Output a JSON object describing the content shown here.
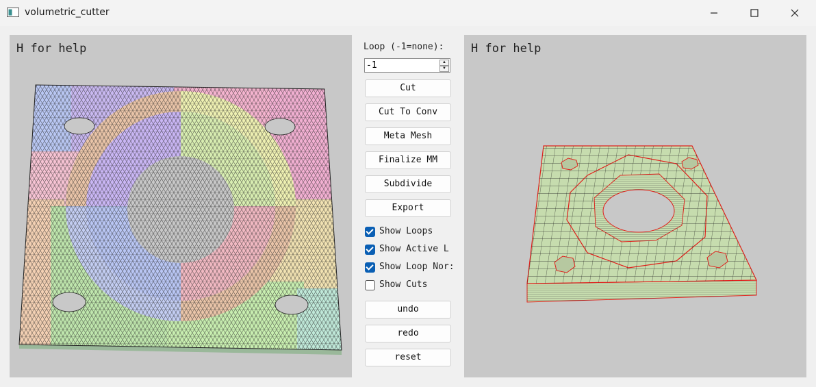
{
  "window": {
    "title": "volumetric_cutter"
  },
  "left_view": {
    "help_text": "H for help"
  },
  "right_view": {
    "help_text": "H for help"
  },
  "controls": {
    "loop_label": "Loop (-1=none):",
    "loop_value": "-1",
    "buttons": {
      "cut": "Cut",
      "cut_to_conv": "Cut To Conv",
      "meta_mesh": "Meta Mesh",
      "finalize_mm": "Finalize MM",
      "subdivide": "Subdivide",
      "export": "Export",
      "undo": "undo",
      "redo": "redo",
      "reset": "reset"
    },
    "checkboxes": {
      "show_loops": {
        "label": "Show Loops",
        "checked": true
      },
      "show_active": {
        "label": "Show Active L",
        "checked": true
      },
      "show_loop_normals": {
        "label": "Show Loop Nor:",
        "checked": true
      },
      "show_cuts": {
        "label": "Show Cuts",
        "checked": false
      }
    }
  },
  "colors": {
    "viewport_bg": "#c8c8c8",
    "checkbox_accent": "#0a5fb4",
    "hex_mesh_fill": "#c6dcae",
    "hex_mesh_outline": "#e0201c"
  }
}
